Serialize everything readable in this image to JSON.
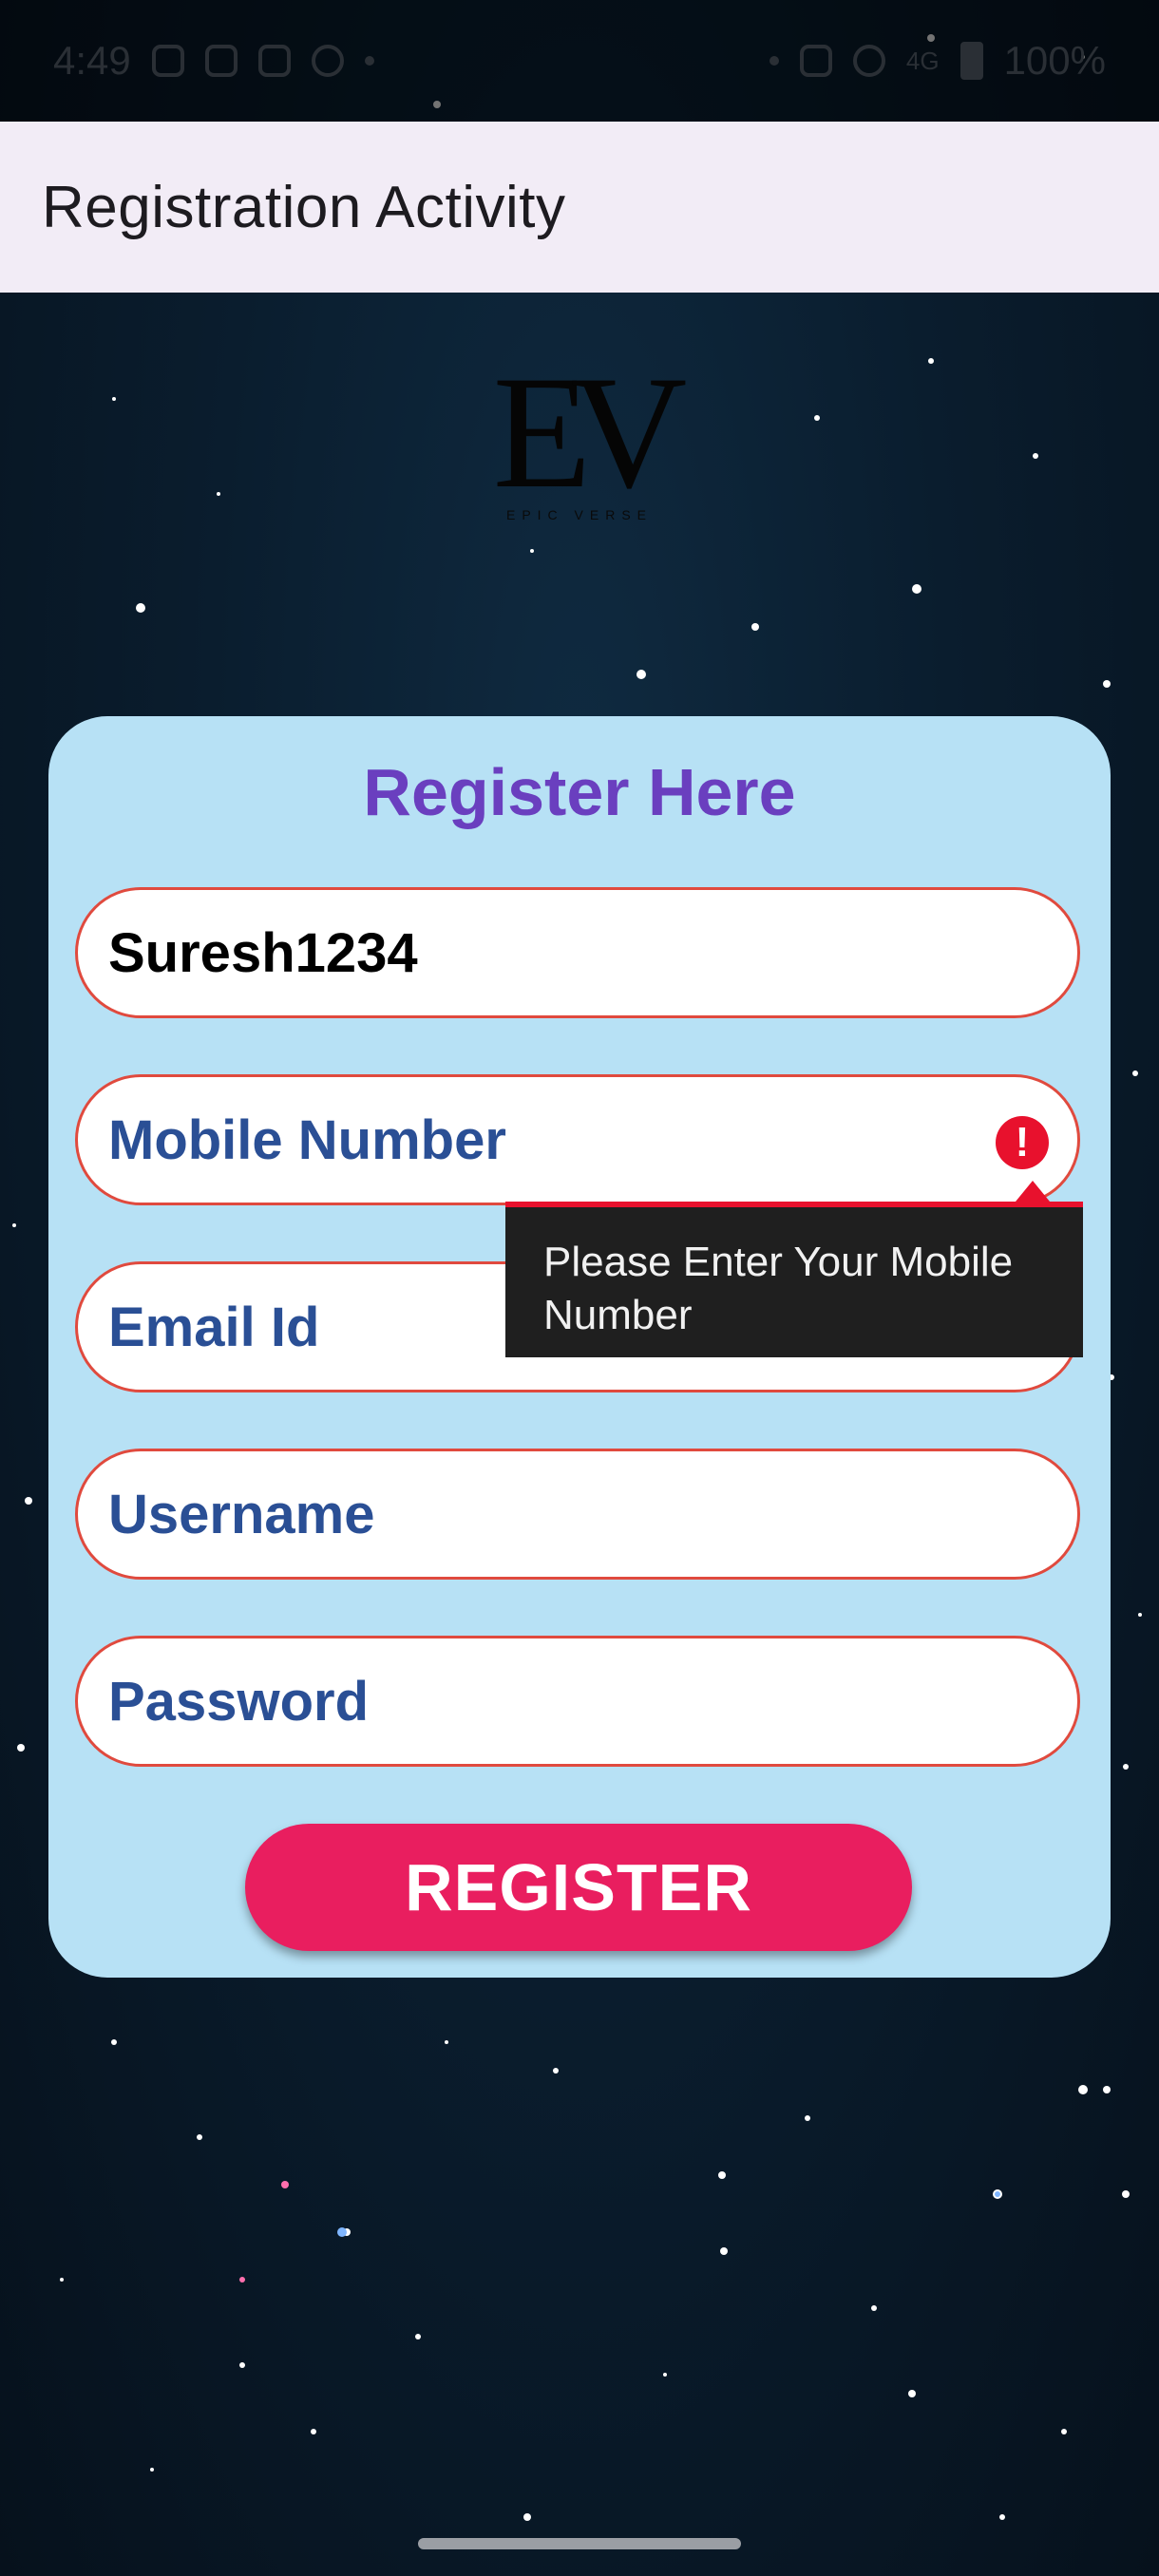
{
  "status_bar": {
    "time": "4:49",
    "signal": "4G",
    "battery": "100%"
  },
  "app_bar": {
    "title": "Registration Activity"
  },
  "logo": {
    "mark": "EV",
    "subtitle": "EPIC VERSE"
  },
  "form": {
    "title": "Register Here",
    "fields": [
      {
        "value": "Suresh1234",
        "placeholder": ""
      },
      {
        "value": "",
        "placeholder": "Mobile Number"
      },
      {
        "value": "",
        "placeholder": "Email Id"
      },
      {
        "value": "",
        "placeholder": "Username"
      },
      {
        "value": "",
        "placeholder": "Password"
      }
    ],
    "error_tooltip": "Please Enter Your Mobile Number",
    "register_label": "REGISTER"
  },
  "colors": {
    "card_bg": "#b7e1f5",
    "title": "#6a3fbf",
    "placeholder": "#2a4f95",
    "field_border": "#e04a3e",
    "button": "#e91e5f",
    "error": "#e8112d"
  }
}
